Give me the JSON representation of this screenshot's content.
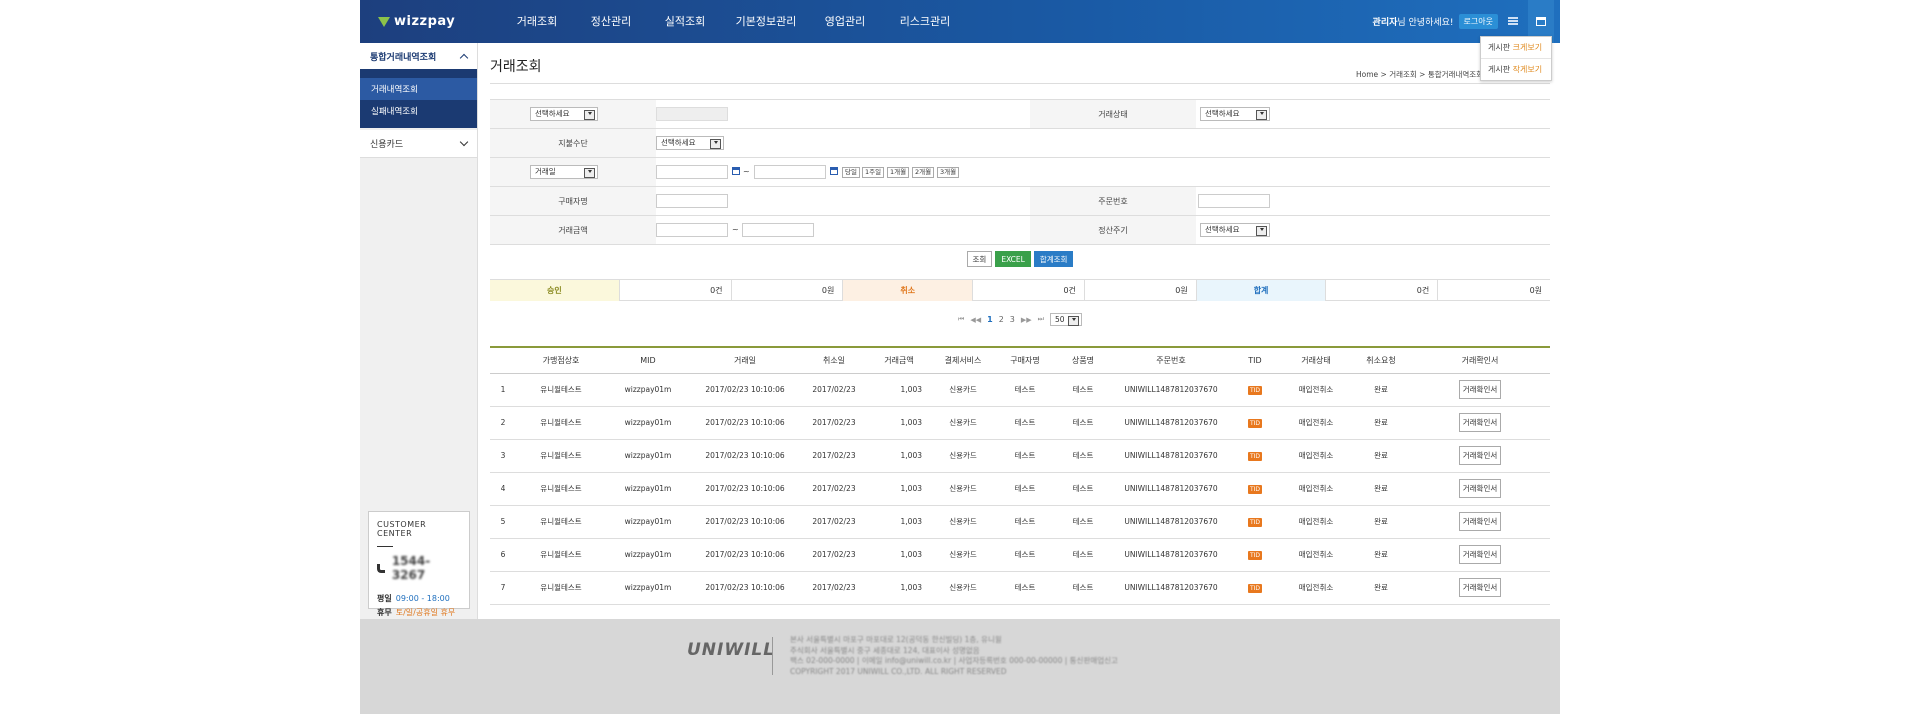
{
  "header": {
    "logo": "wizzpay",
    "nav": [
      "거래조회",
      "정산관리",
      "실적조회",
      "기본정보관리",
      "영업관리",
      "리스크관리"
    ],
    "user_name": "관리자",
    "user_greeting": "님 안녕하세요!",
    "logout": "로그아웃",
    "dropdown": [
      {
        "prefix": "게시판",
        "action": "크게보기"
      },
      {
        "prefix": "게시판",
        "action": "작게보기"
      }
    ]
  },
  "sidebar": {
    "section": "통합거래내역조회",
    "sub_items": [
      "거래내역조회",
      "실패내역조회"
    ],
    "item": "신용카드",
    "customer_center": {
      "title": "CUSTOMER CENTER",
      "phone": "1544-3267",
      "weekday_label": "평일",
      "weekday_value": "09:00 - 18:00",
      "holiday_label": "휴무",
      "holiday_value": "토/일/공휴일 휴무"
    }
  },
  "main": {
    "title": "거래조회",
    "breadcrumb": "Home  >  거래조회  >  통합거래내역조회",
    "search": {
      "row1_select": "선택하세요",
      "status_label": "거래상태",
      "status_select": "선택하세요",
      "payment_label": "지불수단",
      "payment_select": "선택하세요",
      "date_select": "거래일",
      "tilde": "~",
      "periods": [
        "당일",
        "1주일",
        "1개월",
        "2개월",
        "3개월"
      ],
      "buyer_label": "구매자명",
      "order_label": "주문번호",
      "amount_label": "거래금액",
      "settle_label": "정산주기",
      "settle_select": "선택하세요"
    },
    "buttons": {
      "search": "조회",
      "excel": "EXCEL",
      "total": "합계조회"
    },
    "summary": {
      "approved_label": "승인",
      "approved_count": "0건",
      "approved_amount": "0원",
      "cancel_label": "취소",
      "cancel_count": "0건",
      "cancel_amount": "0원",
      "total_label": "합계",
      "total_count": "0건",
      "total_amount": "0원"
    },
    "pager": {
      "pages": [
        "1",
        "2",
        "3"
      ],
      "page_size": "50"
    },
    "table": {
      "columns": [
        "",
        "가맹점상호",
        "MID",
        "거래일",
        "취소일",
        "거래금액",
        "결제서비스",
        "구매자명",
        "상품명",
        "주문번호",
        "TID",
        "거래상태",
        "취소요청",
        "거래확인서"
      ],
      "rows": [
        {
          "no": "1",
          "store": "유니윌테스트",
          "mid": "wizzpay01m",
          "date": "2017/02/23 10:10:06",
          "cancel": "2017/02/23",
          "amount": "1,003",
          "service": "신용카드",
          "buyer": "테스트",
          "product": "테스트",
          "order": "UNIWILL1487812037670",
          "tid": "TID",
          "status": "매입전취소",
          "req": "완료",
          "doc": "거래확인서"
        },
        {
          "no": "2",
          "store": "유니윌테스트",
          "mid": "wizzpay01m",
          "date": "2017/02/23 10:10:06",
          "cancel": "2017/02/23",
          "amount": "1,003",
          "service": "신용카드",
          "buyer": "테스트",
          "product": "테스트",
          "order": "UNIWILL1487812037670",
          "tid": "TID",
          "status": "매입전취소",
          "req": "완료",
          "doc": "거래확인서"
        },
        {
          "no": "3",
          "store": "유니윌테스트",
          "mid": "wizzpay01m",
          "date": "2017/02/23 10:10:06",
          "cancel": "2017/02/23",
          "amount": "1,003",
          "service": "신용카드",
          "buyer": "테스트",
          "product": "테스트",
          "order": "UNIWILL1487812037670",
          "tid": "TID",
          "status": "매입전취소",
          "req": "완료",
          "doc": "거래확인서"
        },
        {
          "no": "4",
          "store": "유니윌테스트",
          "mid": "wizzpay01m",
          "date": "2017/02/23 10:10:06",
          "cancel": "2017/02/23",
          "amount": "1,003",
          "service": "신용카드",
          "buyer": "테스트",
          "product": "테스트",
          "order": "UNIWILL1487812037670",
          "tid": "TID",
          "status": "매입전취소",
          "req": "완료",
          "doc": "거래확인서"
        },
        {
          "no": "5",
          "store": "유니윌테스트",
          "mid": "wizzpay01m",
          "date": "2017/02/23 10:10:06",
          "cancel": "2017/02/23",
          "amount": "1,003",
          "service": "신용카드",
          "buyer": "테스트",
          "product": "테스트",
          "order": "UNIWILL1487812037670",
          "tid": "TID",
          "status": "매입전취소",
          "req": "완료",
          "doc": "거래확인서"
        },
        {
          "no": "6",
          "store": "유니윌테스트",
          "mid": "wizzpay01m",
          "date": "2017/02/23 10:10:06",
          "cancel": "2017/02/23",
          "amount": "1,003",
          "service": "신용카드",
          "buyer": "테스트",
          "product": "테스트",
          "order": "UNIWILL1487812037670",
          "tid": "TID",
          "status": "매입전취소",
          "req": "완료",
          "doc": "거래확인서"
        },
        {
          "no": "7",
          "store": "유니윌테스트",
          "mid": "wizzpay01m",
          "date": "2017/02/23 10:10:06",
          "cancel": "2017/02/23",
          "amount": "1,003",
          "service": "신용카드",
          "buyer": "테스트",
          "product": "테스트",
          "order": "UNIWILL1487812037670",
          "tid": "TID",
          "status": "매입전취소",
          "req": "완료",
          "doc": "거래확인서"
        }
      ]
    }
  },
  "footer": {
    "logo": "UNIWILL",
    "lines": [
      "본사 서울특별시 마포구 마포대로 12(공덕동 한신빌딩) 1층, 유니윌",
      "주식회사 서울특별시 중구 세종대로 124, 대표이사 성명없음",
      "팩스 02-000-0000 | 이메일 info@uniwill.co.kr | 사업자등록번호 000-00-00000 | 통신판매업신고",
      "COPYRIGHT 2017 UNIWILL CO.,LTD. ALL RIGHT RESERVED"
    ]
  },
  "colors": {
    "header": "#1a5aa5",
    "sidebar_active": "#1b3a72",
    "excel": "#3aa04a",
    "accent": "#e0781e"
  }
}
